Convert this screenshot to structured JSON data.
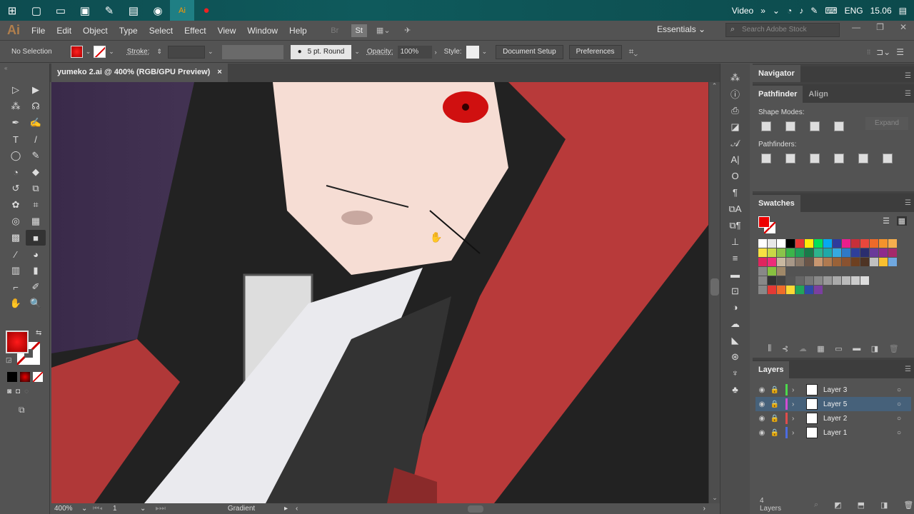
{
  "taskbar": {
    "apps": [
      {
        "name": "start",
        "icon": "⊞"
      },
      {
        "name": "task-view",
        "icon": "▢"
      },
      {
        "name": "cmd",
        "icon": "▭"
      },
      {
        "name": "monitor",
        "icon": "▣"
      },
      {
        "name": "tool",
        "icon": "✎"
      },
      {
        "name": "explorer",
        "icon": "▤"
      },
      {
        "name": "network",
        "icon": "◉"
      },
      {
        "name": "illustrator",
        "icon": "Ai"
      },
      {
        "name": "record",
        "icon": "●"
      }
    ],
    "tray": {
      "label": "Video",
      "overflow": "»",
      "lang": "ENG",
      "time": "15.06"
    }
  },
  "menubar": {
    "logo": "Ai",
    "items": [
      "File",
      "Edit",
      "Object",
      "Type",
      "Select",
      "Effect",
      "View",
      "Window",
      "Help"
    ],
    "bridge": "Br",
    "stock": "St",
    "workspace": "Essentials",
    "search_placeholder": "Search Adobe Stock"
  },
  "controlbar": {
    "selection": "No Selection",
    "stroke_label": "Stroke:",
    "brush": "5 pt. Round",
    "opacity_label": "Opacity:",
    "opacity_value": "100%",
    "style_label": "Style:",
    "document_setup": "Document Setup",
    "preferences": "Preferences"
  },
  "document": {
    "tab_title": "yumeko 2.ai @ 400% (RGB/GPU Preview)",
    "close": "×",
    "zoom": "400%",
    "artboard": "1",
    "status": "Gradient"
  },
  "tools": [
    "▷",
    "▶",
    "⁂",
    "☊",
    "✒",
    "✍",
    "T",
    "/",
    "◯",
    "✎",
    "◔",
    "◆",
    "↺",
    "⧉",
    "✿",
    "⌗",
    "◎",
    "▦",
    "▩",
    "■",
    "⁄",
    "◕",
    "▥",
    "▮",
    "⌐",
    "✐",
    "✋",
    "🔍"
  ],
  "panels": {
    "navigator": "Navigator",
    "pathfinder": {
      "tab": "Pathfinder",
      "tab2": "Align",
      "shape_modes": "Shape Modes:",
      "pathfinders": "Pathfinders:",
      "expand": "Expand"
    },
    "swatches": {
      "tab": "Swatches",
      "rows": [
        [
          "#ffffff",
          "#e8e8e8",
          "#ffffff",
          "#000000",
          "#e53935",
          "#ffeb0a",
          "#00e05a",
          "#06a8f0",
          "#2e3c9c",
          "#e91e8c",
          "#c62f3a",
          "#e8473c",
          "#ee6a2a",
          "#f4932c",
          "#f6ae4d"
        ],
        [
          "#f7e042",
          "#c8d846",
          "#8bc34a",
          "#3bb54a",
          "#20a05a",
          "#1a7a4a",
          "#2db38c",
          "#1fa8a8",
          "#36a9e1",
          "#2f79c7",
          "#2e3f9a",
          "#2b2e6e",
          "#6a3a9a",
          "#8e2a8c",
          "#a52a6a"
        ],
        [
          "#e0245e",
          "#ee2d7a",
          "#c9b8a0",
          "#a89888",
          "#8a7868",
          "#6a5548",
          "#c89670",
          "#b07a50",
          "#9a6238",
          "#8a5230",
          "#6e4020",
          "#4e3424",
          "#c0c0c0",
          "#f8c030",
          "#70a8e0"
        ],
        [
          "#888888",
          "#88c040",
          "#a08868"
        ],
        [
          "#888888",
          "#333333",
          "#444444",
          "#555555",
          "#666666",
          "#777777",
          "#888888",
          "#999999",
          "#aaaaaa",
          "#bbbbbb",
          "#cccccc",
          "#dddddd"
        ],
        [
          "#888888",
          "#e53935",
          "#ef6c2a",
          "#fdd835",
          "#22a55a",
          "#2e4aa8",
          "#7b3fa0"
        ]
      ]
    },
    "layers": {
      "tab": "Layers",
      "count": "4 Layers",
      "items": [
        {
          "name": "Layer 3",
          "color": "#4cd94c",
          "selected": false
        },
        {
          "name": "Layer 5",
          "color": "#d24cd2",
          "selected": true
        },
        {
          "name": "Layer 2",
          "color": "#e04c4c",
          "selected": false
        },
        {
          "name": "Layer 1",
          "color": "#4c6ce0",
          "selected": false
        }
      ]
    }
  },
  "dock_icons": [
    "⁂",
    "ⓘ",
    "⎙",
    "◪",
    "𝒜",
    "A|",
    "O",
    "¶",
    "⧉A",
    "⧉¶",
    "⊥",
    "≡",
    "▬",
    "⊡",
    "◑",
    "☁",
    "◣",
    "⊛",
    "♆",
    "♣"
  ]
}
